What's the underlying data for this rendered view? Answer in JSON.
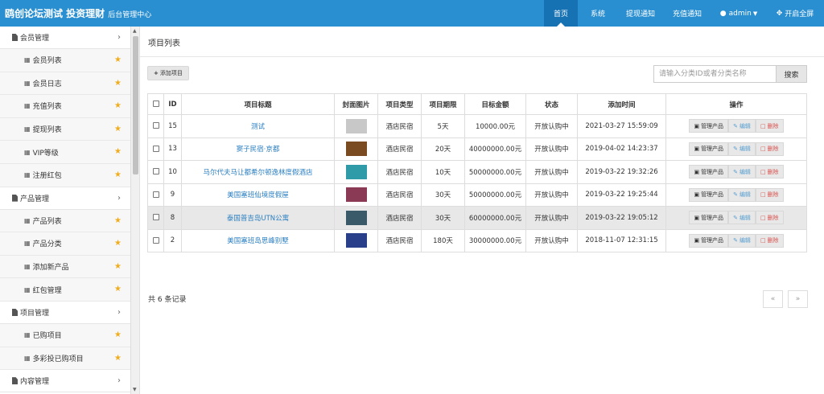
{
  "header": {
    "brand": "鸥创论坛测试 投资理财",
    "subtitle": "后台管理中心",
    "nav": [
      {
        "label": "首页",
        "active": true
      },
      {
        "label": "系统",
        "active": false
      },
      {
        "label": "提现通知",
        "active": false
      },
      {
        "label": "充值通知",
        "active": false
      },
      {
        "label": "admin",
        "active": false,
        "icon": "user-icon",
        "dropdown": true
      },
      {
        "label": "开启全屏",
        "active": false,
        "icon": "fullscreen-icon"
      }
    ]
  },
  "sidebar": {
    "groups": [
      {
        "label": "会员管理",
        "items": [
          "会员列表",
          "会员日志",
          "充值列表",
          "提现列表",
          "VIP等级",
          "注册红包"
        ]
      },
      {
        "label": "产品管理",
        "items": [
          "产品列表",
          "产品分类",
          "添加新产品",
          "红包管理"
        ]
      },
      {
        "label": "项目管理",
        "items": [
          "已购项目",
          "多彩投已购项目"
        ]
      },
      {
        "label": "内容管理",
        "items": []
      }
    ]
  },
  "page": {
    "title": "项目列表",
    "add_button": "添加项目",
    "search_placeholder": "请输入分类ID或者分类名称",
    "search_button": "搜索",
    "total_text": "共 6 条记录",
    "pager_prev": "«",
    "pager_next": "»"
  },
  "table": {
    "headers": [
      "ID",
      "项目标题",
      "封面图片",
      "项目类型",
      "项目期限",
      "目标金额",
      "状态",
      "添加时间",
      "操作"
    ],
    "action_labels": {
      "manage": "管理产品",
      "edit": "编辑",
      "delete": "删除"
    },
    "rows": [
      {
        "id": "15",
        "title": "测试",
        "type": "酒店民宿",
        "term": "5天",
        "amount": "10000.00元",
        "status": "开放认购中",
        "time": "2021-03-27 15:59:09",
        "thumb": "#c8c8c8",
        "highlight": false
      },
      {
        "id": "13",
        "title": "窦子民宿·京都",
        "type": "酒店民宿",
        "term": "20天",
        "amount": "40000000.00元",
        "status": "开放认购中",
        "time": "2019-04-02 14:23:37",
        "thumb": "#7a4a20",
        "highlight": false
      },
      {
        "id": "10",
        "title": "马尔代夫马让都希尔顿逸林度假酒店",
        "type": "酒店民宿",
        "term": "10天",
        "amount": "50000000.00元",
        "status": "开放认购中",
        "time": "2019-03-22 19:32:26",
        "thumb": "#2f9aa8",
        "highlight": false
      },
      {
        "id": "9",
        "title": "美国塞班仙境度假屋",
        "type": "酒店民宿",
        "term": "30天",
        "amount": "50000000.00元",
        "status": "开放认购中",
        "time": "2019-03-22 19:25:44",
        "thumb": "#8a3a55",
        "highlight": false
      },
      {
        "id": "8",
        "title": "泰国普吉岛UTN公寓",
        "type": "酒店民宿",
        "term": "30天",
        "amount": "60000000.00元",
        "status": "开放认购中",
        "time": "2019-03-22 19:05:12",
        "thumb": "#3a5a6a",
        "highlight": true
      },
      {
        "id": "2",
        "title": "美国塞班岛思峰别墅",
        "type": "酒店民宿",
        "term": "180天",
        "amount": "30000000.00元",
        "status": "开放认购中",
        "time": "2018-11-07 12:31:15",
        "thumb": "#2a3f8a",
        "highlight": false
      }
    ]
  },
  "colors": {
    "header": "#2a8fd1",
    "header_active": "#1772b3",
    "link": "#2a7fc1",
    "star": "#f0ad1e",
    "delete": "#d9534f"
  }
}
